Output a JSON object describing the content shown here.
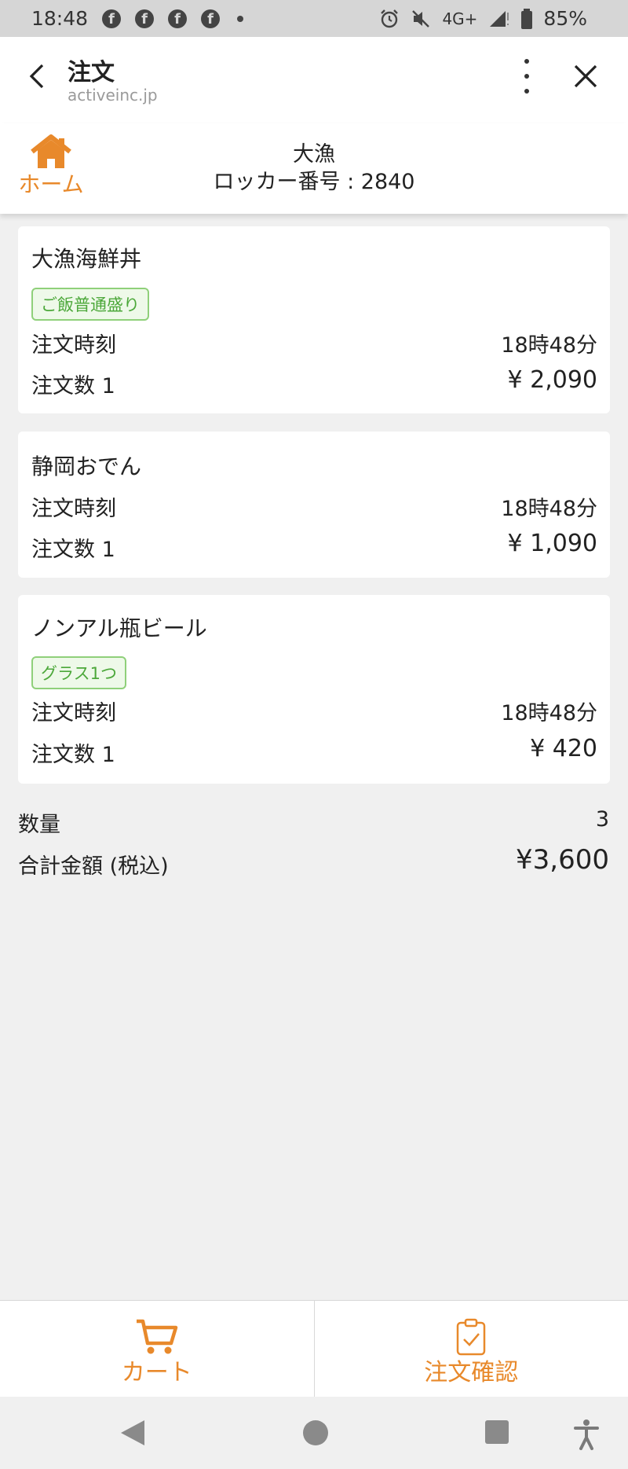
{
  "status_bar": {
    "time": "18:48",
    "notification_icons": [
      "facebook-icon",
      "facebook-icon",
      "facebook-icon",
      "facebook-icon"
    ],
    "network": "4G+",
    "battery": "85%"
  },
  "browser": {
    "title": "注文",
    "url": "activeinc.jp"
  },
  "app_header": {
    "home_label": "ホーム",
    "shop_name": "大漁",
    "locker_text": "ロッカー番号 : 2840"
  },
  "orders": [
    {
      "name": "大漁海鮮丼",
      "option": "ご飯普通盛り",
      "time_label": "注文時刻",
      "time": "18時48分",
      "qty_label": "注文数 1",
      "price": "¥ 2,090"
    },
    {
      "name": "静岡おでん",
      "option": "",
      "time_label": "注文時刻",
      "time": "18時48分",
      "qty_label": "注文数 1",
      "price": "¥ 1,090"
    },
    {
      "name": "ノンアル瓶ビール",
      "option": "グラス1つ",
      "time_label": "注文時刻",
      "time": "18時48分",
      "qty_label": "注文数 1",
      "price": "¥ 420"
    }
  ],
  "summary": {
    "qty_label": "数量",
    "qty_value": "3",
    "total_label": "合計金額 (税込)",
    "total_value": "¥3,600"
  },
  "bottom_nav": {
    "cart_label": "カート",
    "confirm_label": "注文確認"
  },
  "colors": {
    "accent": "#e8892b",
    "badge_green": "#4ca83a",
    "background": "#f0f0f0"
  }
}
